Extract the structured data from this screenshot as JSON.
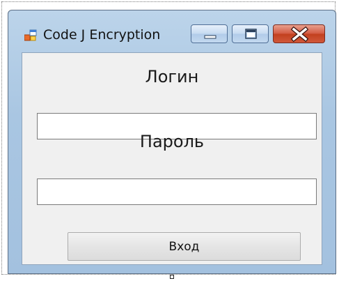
{
  "window": {
    "title": "Code J Encryption",
    "icon": "form-window-icon",
    "caption_buttons": [
      "minimize-icon",
      "maximize-icon",
      "close-icon"
    ],
    "accent_color": "#a9c6e2",
    "close_color": "#c2401f"
  },
  "form": {
    "login_label": "Логин",
    "login_value": "",
    "password_label": "Пароль",
    "password_value": "",
    "submit_label": "Вход"
  }
}
